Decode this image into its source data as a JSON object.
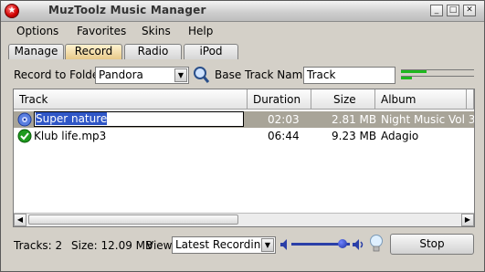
{
  "window": {
    "title": "MuzToolz Music Manager"
  },
  "menu": [
    "Options",
    "Favorites",
    "Skins",
    "Help"
  ],
  "tabs": [
    {
      "label": "Manage",
      "active": false
    },
    {
      "label": "Record",
      "active": true
    },
    {
      "label": "Radio",
      "active": false
    },
    {
      "label": "iPod",
      "active": false
    }
  ],
  "record": {
    "folder_label": "Record to Folder:",
    "folder_value": "Pandora",
    "base_track_label": "Base Track Name:",
    "base_track_value": "Track",
    "level_meters": [
      0.35,
      0.15
    ]
  },
  "table": {
    "columns": [
      "Track",
      "Duration",
      "Size",
      "Album"
    ],
    "rows": [
      {
        "track": "Super nature",
        "duration": "02:03",
        "size": "2.81 MB",
        "album": "Night Music Vol 3",
        "status_icon": "recording-disc-icon",
        "selected": true,
        "editing": true
      },
      {
        "track": "Klub life.mp3",
        "duration": "06:44",
        "size": "9.23 MB",
        "album": "Adagio",
        "status_icon": "check-icon",
        "selected": false,
        "editing": false
      }
    ]
  },
  "status": {
    "tracks_text": "Tracks: 2",
    "size_text": "Size: 12.09 MB",
    "view_label": "View:",
    "view_value": "Latest Recordings",
    "volume": 0.88,
    "stop_label": "Stop"
  },
  "colors": {
    "selected_row": "#a8a498",
    "active_tab": "#e7c98a",
    "slider": "#2a3fa8"
  }
}
